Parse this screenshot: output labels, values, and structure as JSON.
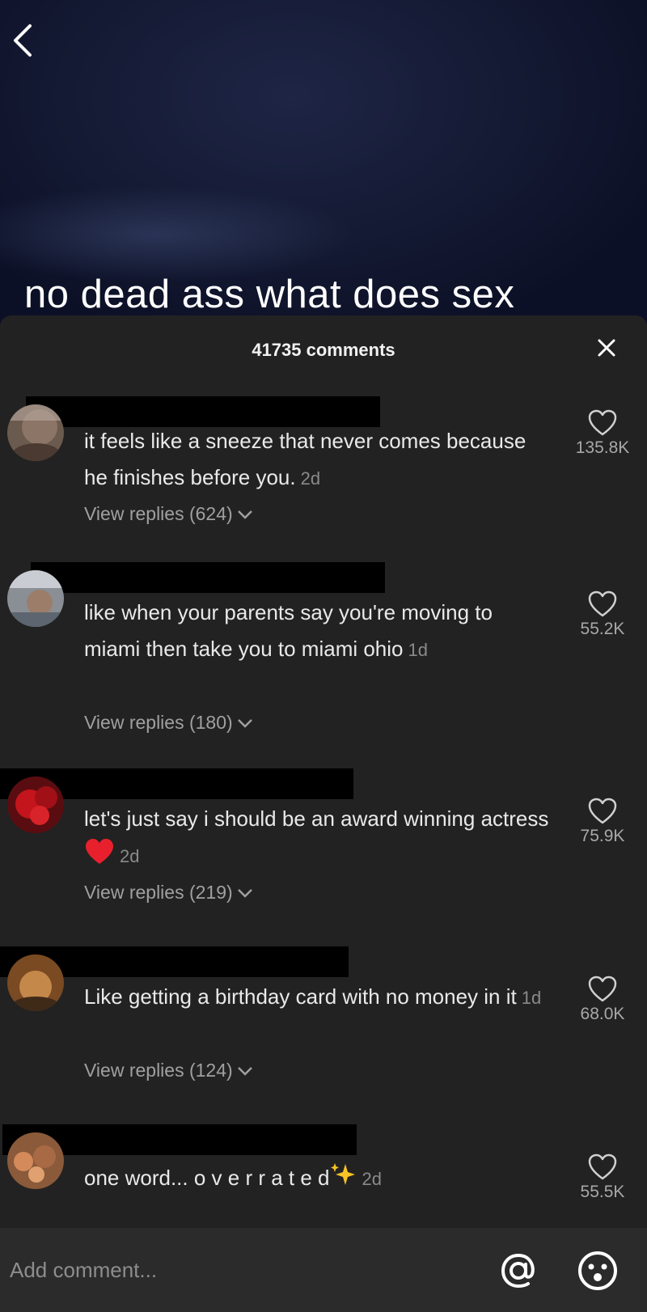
{
  "video": {
    "caption": "no dead ass what does sex"
  },
  "comments_sheet": {
    "title": "41735 comments",
    "items": [
      {
        "text": "it feels like a sneeze that never comes because he finishes before you.",
        "time": "2d",
        "likes": "135.8K",
        "replies_label": "View replies (624)"
      },
      {
        "text": "like when your parents say you're moving to miami then take you to miami ohio",
        "time": "1d",
        "likes": "55.2K",
        "replies_label": "View replies (180)"
      },
      {
        "text": "let's just say i should be an award winning actress",
        "emoji": "red-heart",
        "time": "2d",
        "likes": "75.9K",
        "replies_label": "View replies (219)"
      },
      {
        "text": "Like getting a birthday card with no money in it",
        "time": "1d",
        "likes": "68.0K",
        "replies_label": "View replies (124)"
      },
      {
        "text": "one word... o v e r r a t e d",
        "emoji": "sparkles",
        "time": "2d",
        "likes": "55.5K"
      }
    ]
  },
  "input_bar": {
    "placeholder": "Add comment..."
  },
  "icons": {
    "back": "chevron-left-icon",
    "close": "close-icon",
    "like": "heart-outline-icon",
    "chevron": "chevron-down-icon",
    "mention": "at-sign-icon",
    "emoji": "smiley-face-icon"
  },
  "colors": {
    "sheet_background": "#222222",
    "input_background": "#2b2b2b",
    "secondary_text": "#a0a0a0",
    "heart_emoji": "#e8202e"
  }
}
